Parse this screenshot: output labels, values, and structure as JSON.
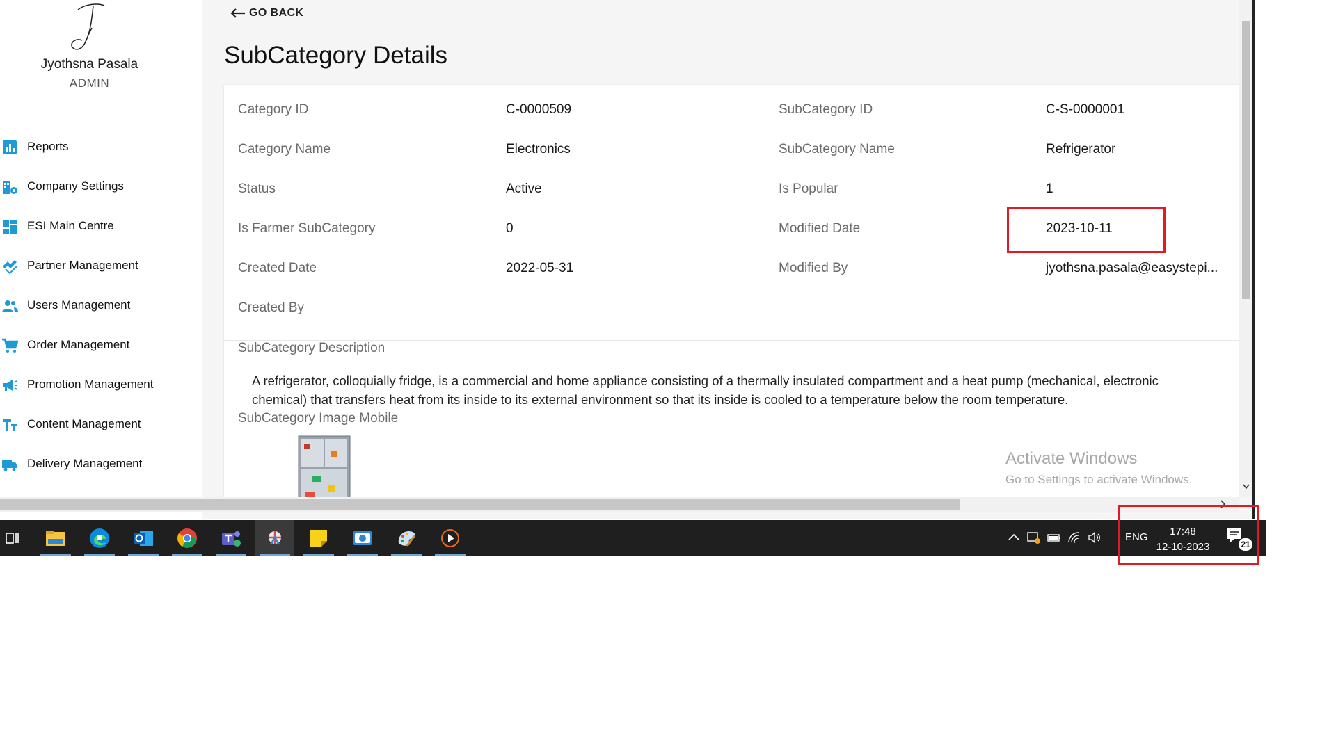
{
  "user": {
    "name": "Jyothsna Pasala",
    "role": "ADMIN"
  },
  "sidebar": {
    "items": [
      {
        "label": "Reports",
        "icon": "bar-chart-icon"
      },
      {
        "label": "Company Settings",
        "icon": "building-settings-icon"
      },
      {
        "label": "ESI Main Centre",
        "icon": "dashboard-grid-icon"
      },
      {
        "label": "Partner Management",
        "icon": "handshake-icon"
      },
      {
        "label": "Users Management",
        "icon": "users-icon"
      },
      {
        "label": "Order Management",
        "icon": "cart-icon"
      },
      {
        "label": "Promotion Management",
        "icon": "megaphone-icon"
      },
      {
        "label": "Content Management",
        "icon": "text-size-icon"
      },
      {
        "label": "Delivery Management",
        "icon": "truck-icon"
      }
    ]
  },
  "main": {
    "go_back": "GO BACK",
    "title": "SubCategory Details",
    "fields": {
      "category_id_label": "Category ID",
      "category_id": "C-0000509",
      "subcategory_id_label": "SubCategory ID",
      "subcategory_id": "C-S-0000001",
      "category_name_label": "Category Name",
      "category_name": "Electronics",
      "subcategory_name_label": "SubCategory Name",
      "subcategory_name": "Refrigerator",
      "status_label": "Status",
      "status": "Active",
      "is_popular_label": "Is Popular",
      "is_popular": "1",
      "is_farmer_label": "Is Farmer SubCategory",
      "is_farmer": "0",
      "modified_date_label": "Modified Date",
      "modified_date": "2023-10-11",
      "created_date_label": "Created Date",
      "created_date": "2022-05-31",
      "modified_by_label": "Modified By",
      "modified_by": "jyothsna.pasala@easystepi...",
      "created_by_label": "Created By",
      "created_by": ""
    },
    "description_label": "SubCategory Description",
    "description_line1": "A refrigerator, colloquially fridge, is a commercial and home appliance consisting of a thermally insulated compartment and a heat pump (mechanical, electronic",
    "description_line2": "chemical) that transfers heat from its inside to its external environment so that its inside is cooled to a temperature below the room temperature.",
    "image_mobile_label": "SubCategory Image Mobile"
  },
  "watermark": {
    "line1": "Activate Windows",
    "line2": "Go to Settings to activate Windows."
  },
  "taskbar": {
    "apps": [
      "task-view-icon",
      "file-explorer-icon",
      "edge-icon",
      "outlook-icon",
      "chrome-icon",
      "teams-icon",
      "snipping-tool-icon",
      "sticky-notes-icon",
      "camera-icon",
      "paint-icon",
      "media-player-icon"
    ],
    "language": "ENG",
    "time": "17:48",
    "date": "12-10-2023",
    "notification_count": "21"
  },
  "colors": {
    "accent": "#1e9bd7",
    "highlight": "#e01b24",
    "taskbar": "#1f1f1f"
  }
}
